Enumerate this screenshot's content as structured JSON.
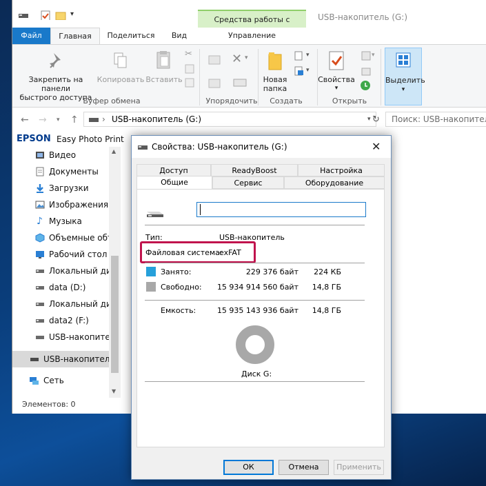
{
  "explorer": {
    "window_title": "USB-накопитель (G:)",
    "contextual_tab_header": "Средства работы с дисками",
    "tabs": {
      "file": "Файл",
      "home": "Главная",
      "share": "Поделиться",
      "view": "Вид",
      "manage": "Управление"
    },
    "ribbon": {
      "pin_line1": "Закрепить на панели",
      "pin_line2": "быстрого доступа",
      "copy": "Копировать",
      "paste": "Вставить",
      "new_folder_line1": "Новая",
      "new_folder_line2": "папка",
      "properties": "Свойства",
      "select_all": "Выделить",
      "groups": {
        "clipboard": "Буфер обмена",
        "organize": "Упорядочить",
        "new": "Создать",
        "open": "Открыть"
      }
    },
    "address": {
      "path": "USB-накопитель (G:)",
      "search_placeholder": "Поиск: USB-накопитель (G:)"
    },
    "epson": {
      "brand": "EPSON",
      "app": "Easy Photo Print"
    },
    "nav_items": [
      {
        "label": "Видео",
        "icon": "video-icon"
      },
      {
        "label": "Документы",
        "icon": "documents-icon"
      },
      {
        "label": "Загрузки",
        "icon": "downloads-icon"
      },
      {
        "label": "Изображения",
        "icon": "pictures-icon"
      },
      {
        "label": "Музыка",
        "icon": "music-icon"
      },
      {
        "label": "Объемные объ",
        "icon": "3d-objects-icon"
      },
      {
        "label": "Рабочий стол",
        "icon": "desktop-icon"
      },
      {
        "label": "Локальный дис",
        "icon": "drive-icon"
      },
      {
        "label": "data (D:)",
        "icon": "drive-icon"
      },
      {
        "label": "Локальный дис",
        "icon": "drive-icon"
      },
      {
        "label": "data2 (F:)",
        "icon": "drive-icon"
      },
      {
        "label": "USB-накопител",
        "icon": "usb-drive-icon"
      },
      {
        "label": "USB-накопитель",
        "icon": "usb-drive-icon"
      },
      {
        "label": "Сеть",
        "icon": "network-icon"
      }
    ],
    "status": "Элементов: 0"
  },
  "dialog": {
    "title": "Свойства: USB-накопитель (G:)",
    "tabs_row1": [
      "Доступ",
      "ReadyBoost",
      "Настройка"
    ],
    "tabs_row2": [
      "Общие",
      "Сервис",
      "Оборудование"
    ],
    "name_value": "",
    "type_label": "Тип:",
    "type_value": "USB-накопитель",
    "fs_label": "Файловая система:",
    "fs_value": "exFAT",
    "used_label": "Занято:",
    "used_bytes": "229 376 байт",
    "used_size": "224 КБ",
    "free_label": "Свободно:",
    "free_bytes": "15 934 914 560 байт",
    "free_size": "14,8 ГБ",
    "capacity_label": "Емкость:",
    "capacity_bytes": "15 935 143 936 байт",
    "capacity_size": "14,8 ГБ",
    "disk_label": "Диск G:",
    "used_fraction": 1.44e-05,
    "colors": {
      "used": "#26a0da",
      "free": "#a8a8a8",
      "highlight": "#c0134d"
    },
    "buttons": {
      "ok": "ОК",
      "cancel": "Отмена",
      "apply": "Применить"
    }
  }
}
